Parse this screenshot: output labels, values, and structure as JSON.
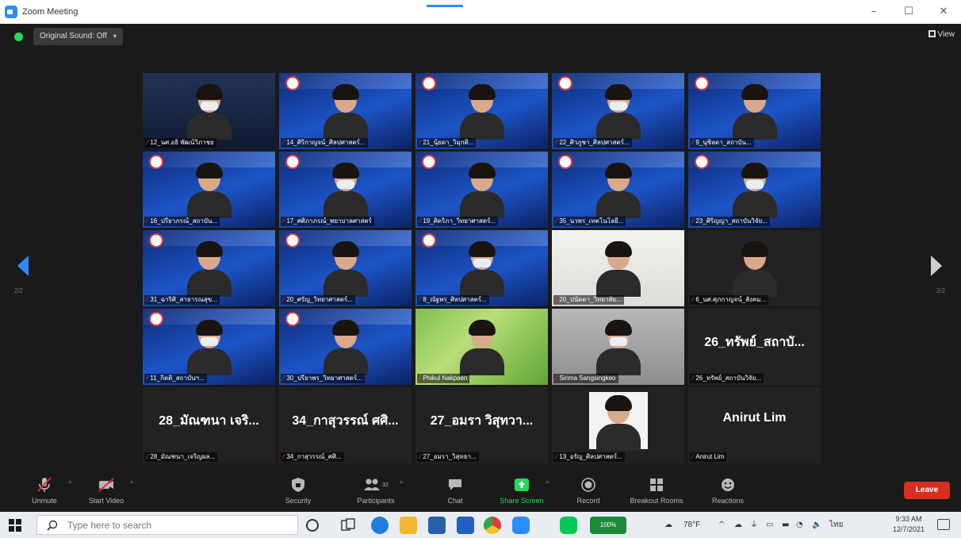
{
  "window": {
    "title": "Zoom Meeting",
    "minimize_label": "–",
    "maximize_label": "☐",
    "close_label": "✕"
  },
  "meeting_header": {
    "original_sound": "Original Sound: Off",
    "view_label": "View"
  },
  "pager": {
    "prev_page": "2/2",
    "next_page": "2/2"
  },
  "tiles": [
    {
      "label": "12_นศ.อธิ พัฒน์วิภาชย",
      "bg": "night"
    },
    {
      "label": "14_ศิริกาญจน์_ศิลปศาสตร์...",
      "bg": "slide"
    },
    {
      "label": "21_นุ้ยดา_วิมุกติ...",
      "bg": "slide"
    },
    {
      "label": "22_ศิวภูชา_ศิลปศาสตร์...",
      "bg": "slide"
    },
    {
      "label": "9_นุชิลดา_สถาบัน...",
      "bg": "slide"
    },
    {
      "label": "16_ปรียาภรณ์_สถาบัน...",
      "bg": "slide"
    },
    {
      "label": "17_ศศิภาภรณ์_พยาบาลศาสตร์",
      "bg": "slide"
    },
    {
      "label": "19_ศิตริภา_วิทยาศาสตร์...",
      "bg": "slide"
    },
    {
      "label": "35_นวพร_เทคโนโลยี...",
      "bg": "slide"
    },
    {
      "label": "23_ศิริญญา_สถาบันวิจัย...",
      "bg": "slide"
    },
    {
      "label": "31_ฉาริศิ_สาธารณสุข...",
      "bg": "slide"
    },
    {
      "label": "20_ศรัญ_วิทยาศาสตร์...",
      "bg": "slide"
    },
    {
      "label": "8_ณัฐพร_ศิลปศาสตร์...",
      "bg": "slide"
    },
    {
      "label": "20_ปนัดดา_วิทยาลัย...",
      "bg": "room"
    },
    {
      "label": "6_นศ.ศุภกาญจน์_สังคม...",
      "bg": "dark"
    },
    {
      "label": "11_กิตติ_สถาบันฯ...",
      "bg": "slide"
    },
    {
      "label": "30_ปรียาพร_วิทยาศาสตร์...",
      "bg": "slide"
    },
    {
      "label": "Phikul Nakpaen",
      "bg": "green"
    },
    {
      "label": "Sirima Sangsingkeo",
      "bg": "grey"
    },
    {
      "label": "26_ทรัพย์_สถาบันวิจัย...",
      "bg": "dark",
      "display_name": "26_ทรัพย์_สถาบั..."
    },
    {
      "label": "28_มัณฑนา_เจริญผล...",
      "bg": "dark",
      "display_name": "28_มัณฑนา เจริ..."
    },
    {
      "label": "34_กาสุวรรณ์_ศศิ...",
      "bg": "dark",
      "display_name": "34_กาสุวรรณ์ ศศิ..."
    },
    {
      "label": "27_อมรา_วิสุทธา...",
      "bg": "dark",
      "display_name": "27_อมรา วิสุทวา..."
    },
    {
      "label": "13_อรัญ_ศิลปศาสตร์...",
      "bg": "photo"
    },
    {
      "label": "Anirut Lim",
      "bg": "dark",
      "display_name": "Anirut Lim"
    }
  ],
  "toolbar": {
    "unmute": "Unmute",
    "start_video": "Start Video",
    "security": "Security",
    "participants": "Participants",
    "participant_count": "32",
    "chat": "Chat",
    "share_screen": "Share Screen",
    "record": "Record",
    "breakout_rooms": "Breakout Rooms",
    "reactions": "Reactions",
    "leave": "Leave"
  },
  "taskbar": {
    "search_placeholder": "Type here to search",
    "battery_label": "100%",
    "weather": "78°F",
    "lang": "ไทย",
    "time": "9:33 AM",
    "date": "12/7/2021"
  },
  "colors": {
    "zoom_blue": "#2d8cff",
    "secure_green": "#23d959",
    "leave_red": "#d92d20",
    "muted_red": "#e02828"
  }
}
